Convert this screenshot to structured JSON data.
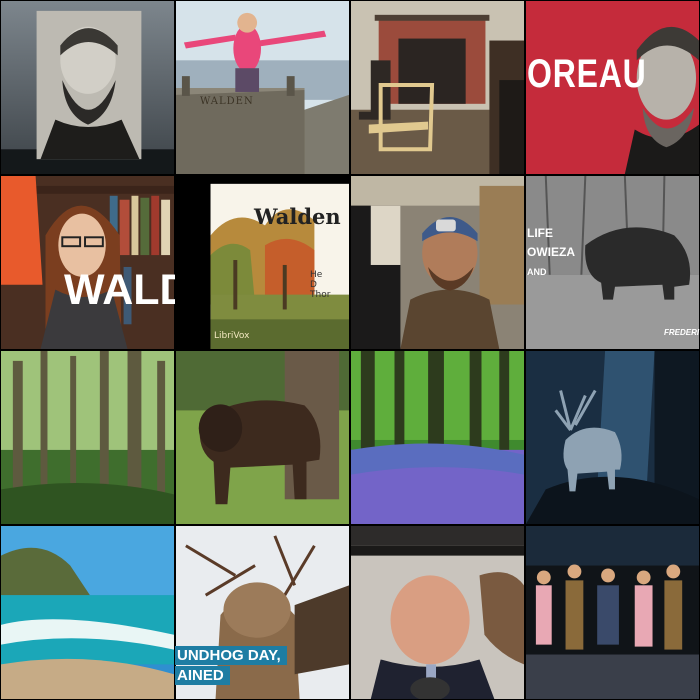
{
  "tiles": {
    "thoreau_banner": {
      "text": "OREAU"
    },
    "reader_video": {
      "text": "WALD"
    },
    "walden_book": {
      "title": "Walden",
      "subtitle": [
        "He",
        "D",
        "Thor"
      ],
      "publisher": "LibriVox"
    },
    "summit_sign": {
      "text": "WALDEN"
    },
    "wildlife": {
      "line1": "LIFE",
      "line2": "OWIEZA",
      "line3": "AND",
      "credit": "FREDERI"
    },
    "groundhog": {
      "line1": "UNDHOG DAY,",
      "line2": "AINED"
    }
  }
}
